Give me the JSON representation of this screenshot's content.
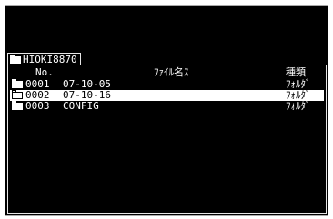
{
  "path_tab": {
    "label": "HIOKI8870"
  },
  "header": {
    "no": "No.",
    "name": "ﾌｧｲﾙ名ｽ",
    "type": "種類"
  },
  "rows": [
    {
      "num": "0001",
      "name": "07-10-05",
      "type": "ﾌｫﾙﾀﾞ"
    },
    {
      "num": "0002",
      "name": "07-10-16",
      "type": "ﾌｫﾙﾀﾞ"
    },
    {
      "num": "0003",
      "name": "CONFIG",
      "type": "ﾌｫﾙﾀﾞ"
    }
  ],
  "selected_row": 1,
  "icons": {
    "folder": "folder-icon"
  },
  "colors": {
    "background": "#000000",
    "text": "#ffffff",
    "selection": "#ffffff"
  }
}
